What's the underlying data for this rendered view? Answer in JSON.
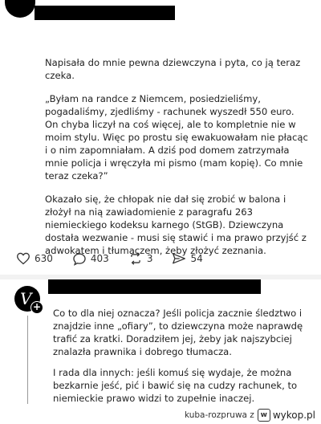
{
  "post": {
    "paragraphs": [
      "Napisała do mnie pewna dziewczyna i pyta, co ją teraz czeka.",
      "„Byłam na randce z Niemcem, posiedzieliśmy, pogadaliśmy, zjedliśmy - rachunek wyszedł 550 euro. On chyba liczył na coś więcej, ale to kompletnie nie w moim stylu. Więc po prostu się ewakuowałam nie płacąc i o nim zapomniałam. A dziś pod domem zatrzymała mnie policja i wręczyła mi pismo (mam kopię). Co mnie teraz czeka?”",
      "Okazało się, że chłopak nie dał się zrobić w balona i złożył na nią zawiadomienie z paragrafu 263 niemieckiego kodeksu karnego (StGB). Dziewczyna dostała wezwanie - musi się stawić i ma prawo przyjść z adwokatem i tłumaczem, żeby złożyć zeznania."
    ],
    "actions": {
      "likes": "630",
      "comments": "403",
      "reposts": "3",
      "shares": "54"
    }
  },
  "reply": {
    "avatar_letter": "V",
    "badge": "+",
    "paragraphs": [
      "Co to dla niej oznacza? Jeśli policja zacznie śledztwo i znajdzie inne „ofiary”, to dziewczyna może naprawdę trafić za kratki. Doradziłem jej, żeby jak najszybciej znalazła prawnika i dobrego tłumacza.",
      "I rada dla innych: jeśli komuś się wydaje, że można bezkarnie jeść, pić i bawić się na cudzy rachunek, to niemieckie prawo widzi to zupełnie inaczej."
    ]
  },
  "watermark": {
    "user": "kuba-rozpruwa z",
    "logo_icon": "wykop-logo-icon",
    "site": "wykop.pl"
  }
}
